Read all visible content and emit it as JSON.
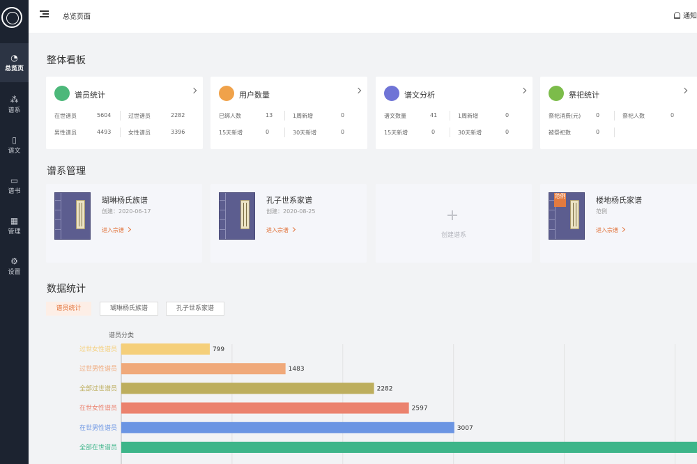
{
  "sidebar": {
    "items": [
      {
        "label": "总览页",
        "icon": "pie-chart-icon",
        "active": true
      },
      {
        "label": "谱系",
        "icon": "hierarchy-icon"
      },
      {
        "label": "谱文",
        "icon": "document-icon"
      },
      {
        "label": "谱书",
        "icon": "open-book-icon"
      },
      {
        "label": "管理",
        "icon": "grid-icon"
      },
      {
        "label": "设置",
        "icon": "gear-icon"
      }
    ]
  },
  "header": {
    "title": "总览页面",
    "notify": "通知"
  },
  "overview": {
    "title": "整体看板",
    "cards": [
      {
        "title": "谱员统计",
        "color": "#4cb87a",
        "rows": [
          [
            "在世谱员",
            "5604",
            "过世谱员",
            "2282"
          ],
          [
            "男性谱员",
            "4493",
            "女性谱员",
            "3396"
          ]
        ]
      },
      {
        "title": "用户数量",
        "color": "#f0a24a",
        "rows": [
          [
            "已绑人数",
            "13",
            "1周新增",
            "0"
          ],
          [
            "15天新增",
            "0",
            "30天新增",
            "0"
          ]
        ]
      },
      {
        "title": "谱文分析",
        "color": "#6f74d6",
        "rows": [
          [
            "谱文数量",
            "41",
            "1周新增",
            "0"
          ],
          [
            "15天新增",
            "0",
            "30天新增",
            "0"
          ]
        ]
      },
      {
        "title": "祭祀统计",
        "color": "#7cbc4a",
        "rows": [
          [
            "祭祀消费(元)",
            "0",
            "祭祀人数",
            "0"
          ],
          [
            "被祭祀数",
            "0",
            "",
            ""
          ]
        ]
      }
    ]
  },
  "genealogy": {
    "title": "谱系管理",
    "cards": [
      {
        "name": "瑚琳杨氏族谱",
        "date": "创建：2020-06-17",
        "enter": "进入宗谱"
      },
      {
        "name": "孔子世系家谱",
        "date": "创建：2020-08-25",
        "enter": "进入宗谱"
      },
      {
        "name": "楼地杨氏家谱",
        "date": "范例",
        "enter": "进入宗谱",
        "badge": "范例"
      }
    ],
    "create_label": "创建谱系"
  },
  "stats": {
    "title": "数据统计",
    "tabs": [
      "谱员统计",
      "瑚琳杨氏族谱",
      "孔子世系家谱"
    ],
    "active_tab": 0
  },
  "chart_data": {
    "type": "bar",
    "orientation": "horizontal",
    "ylabel": "谱员分类",
    "categories": [
      "过世女性谱员",
      "过世男性谱员",
      "全部过世谱员",
      "在世女性谱员",
      "在世男性谱员",
      "全部在世谱员"
    ],
    "values": [
      799,
      1483,
      2282,
      2597,
      3007,
      5604
    ],
    "colors": [
      "#f5cf7a",
      "#f0a97a",
      "#bdae5d",
      "#eb826e",
      "#6b95e3",
      "#3db589"
    ],
    "xlim": [
      0,
      5000
    ],
    "grid": true
  }
}
